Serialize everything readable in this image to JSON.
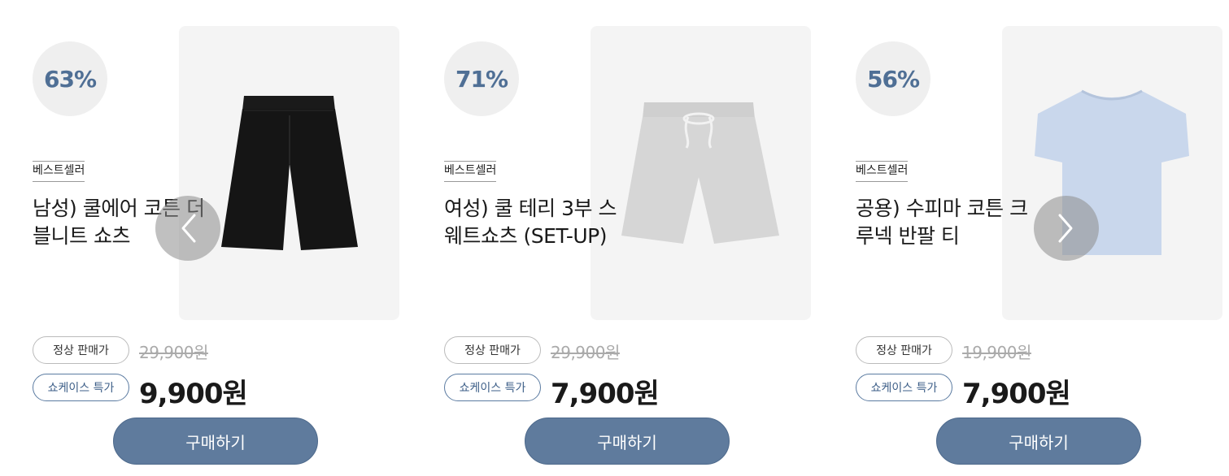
{
  "products": [
    {
      "discount": "63%",
      "badge": "베스트셀러",
      "title": "남성) 쿨에어 코튼 더블니트 쇼츠",
      "regular_label": "정상 판매가",
      "original_price": "29,900원",
      "special_label": "쇼케이스 특가",
      "sale_price": "9,900원",
      "buy_label": "구매하기",
      "image": "black-shorts"
    },
    {
      "discount": "71%",
      "badge": "베스트셀러",
      "title": "여성) 쿨 테리 3부 스웨트쇼츠 (SET-UP)",
      "regular_label": "정상 판매가",
      "original_price": "29,900원",
      "special_label": "쇼케이스 특가",
      "sale_price": "7,900원",
      "buy_label": "구매하기",
      "image": "grey-sweat-shorts"
    },
    {
      "discount": "56%",
      "badge": "베스트셀러",
      "title": "공용) 수피마 코튼 크루넥 반팔 티",
      "regular_label": "정상 판매가",
      "original_price": "19,900원",
      "special_label": "쇼케이스 특가",
      "sale_price": "7,900원",
      "buy_label": "구매하기",
      "image": "light-blue-tshirt"
    }
  ],
  "nav": {
    "prev_icon": "chevron-left-icon",
    "next_icon": "chevron-right-icon"
  },
  "colors": {
    "accent": "#5f7b9d",
    "discount_text": "#4f6f95",
    "image_bg": "#f4f4f4"
  }
}
